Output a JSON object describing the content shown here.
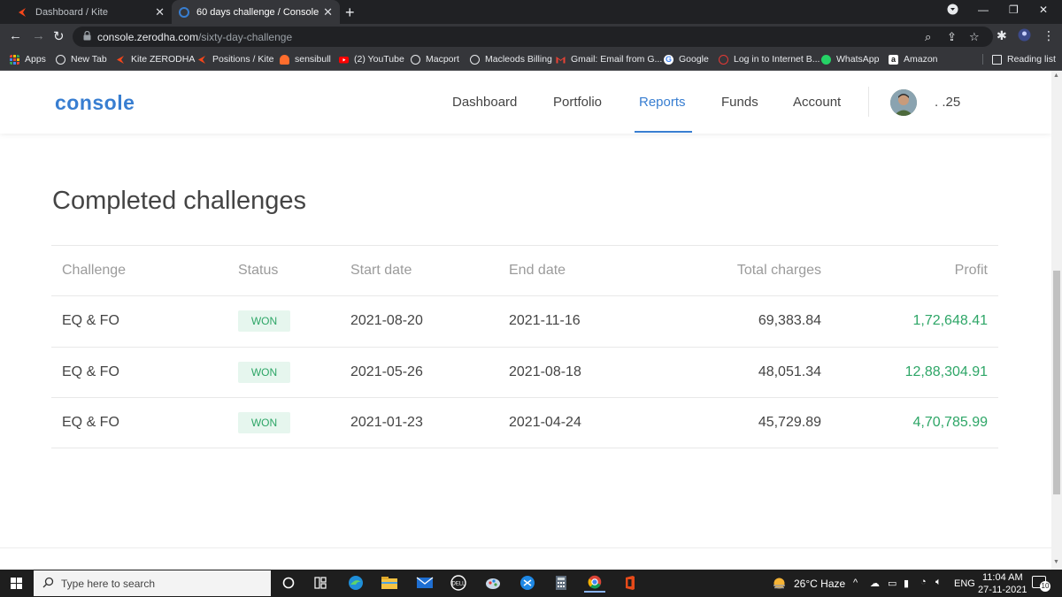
{
  "browser": {
    "tabs": [
      {
        "title": "Dashboard / Kite",
        "active": false
      },
      {
        "title": "60 days challenge / Console",
        "active": true
      }
    ],
    "url_host": "console.zerodha.com",
    "url_path": "/sixty-day-challenge",
    "bookmarks": [
      {
        "label": "Apps",
        "icon": "apps-grid-icon",
        "color": "#ea4335"
      },
      {
        "label": "New Tab",
        "icon": "globe-icon",
        "color": "#e8eaed"
      },
      {
        "label": "Kite ZERODHA",
        "icon": "kite-icon",
        "color": "#f6461a"
      },
      {
        "label": "Positions / Kite",
        "icon": "kite-icon",
        "color": "#f6461a"
      },
      {
        "label": "sensibull",
        "icon": "sensibull-icon",
        "color": "#ff6d2d"
      },
      {
        "label": "(2) YouTube",
        "icon": "youtube-icon",
        "color": "#ff0000"
      },
      {
        "label": "Macport",
        "icon": "globe-icon",
        "color": "#e8eaed"
      },
      {
        "label": "Macleods Billing",
        "icon": "globe-icon",
        "color": "#e8eaed"
      },
      {
        "label": "Gmail: Email from G...",
        "icon": "gmail-icon",
        "color": "#ea4335"
      },
      {
        "label": "Google",
        "icon": "google-icon",
        "color": "#4285f4"
      },
      {
        "label": "Log in to Internet B...",
        "icon": "bank-icon",
        "color": "#e53935"
      },
      {
        "label": "WhatsApp",
        "icon": "whatsapp-icon",
        "color": "#25d366"
      },
      {
        "label": "Amazon",
        "icon": "amazon-icon",
        "color": "#ffffff"
      }
    ],
    "reading_list": "Reading list"
  },
  "console": {
    "logo": "console",
    "nav": [
      {
        "label": "Dashboard",
        "active": false
      },
      {
        "label": "Portfolio",
        "active": false
      },
      {
        "label": "Reports",
        "active": true
      },
      {
        "label": "Funds",
        "active": false
      },
      {
        "label": "Account",
        "active": false
      }
    ],
    "user_id": ". .25",
    "accent": "#387ed1",
    "profit_color": "#2ea667"
  },
  "challenges": {
    "heading": "Completed challenges",
    "columns": [
      "Challenge",
      "Status",
      "Start date",
      "End date",
      "Total charges",
      "Profit"
    ],
    "rows": [
      {
        "challenge": "EQ & FO",
        "status": "WON",
        "start": "2021-08-20",
        "end": "2021-11-16",
        "charges": "69,383.84",
        "profit": "1,72,648.41"
      },
      {
        "challenge": "EQ & FO",
        "status": "WON",
        "start": "2021-05-26",
        "end": "2021-08-18",
        "charges": "48,051.34",
        "profit": "12,88,304.91"
      },
      {
        "challenge": "EQ & FO",
        "status": "WON",
        "start": "2021-01-23",
        "end": "2021-04-24",
        "charges": "45,729.89",
        "profit": "4,70,785.99"
      }
    ]
  },
  "taskbar": {
    "search_placeholder": "Type here to search",
    "weather": "26°C Haze",
    "language": "ENG",
    "time": "11:04 AM",
    "date": "27-11-2021",
    "notifications": "10"
  }
}
